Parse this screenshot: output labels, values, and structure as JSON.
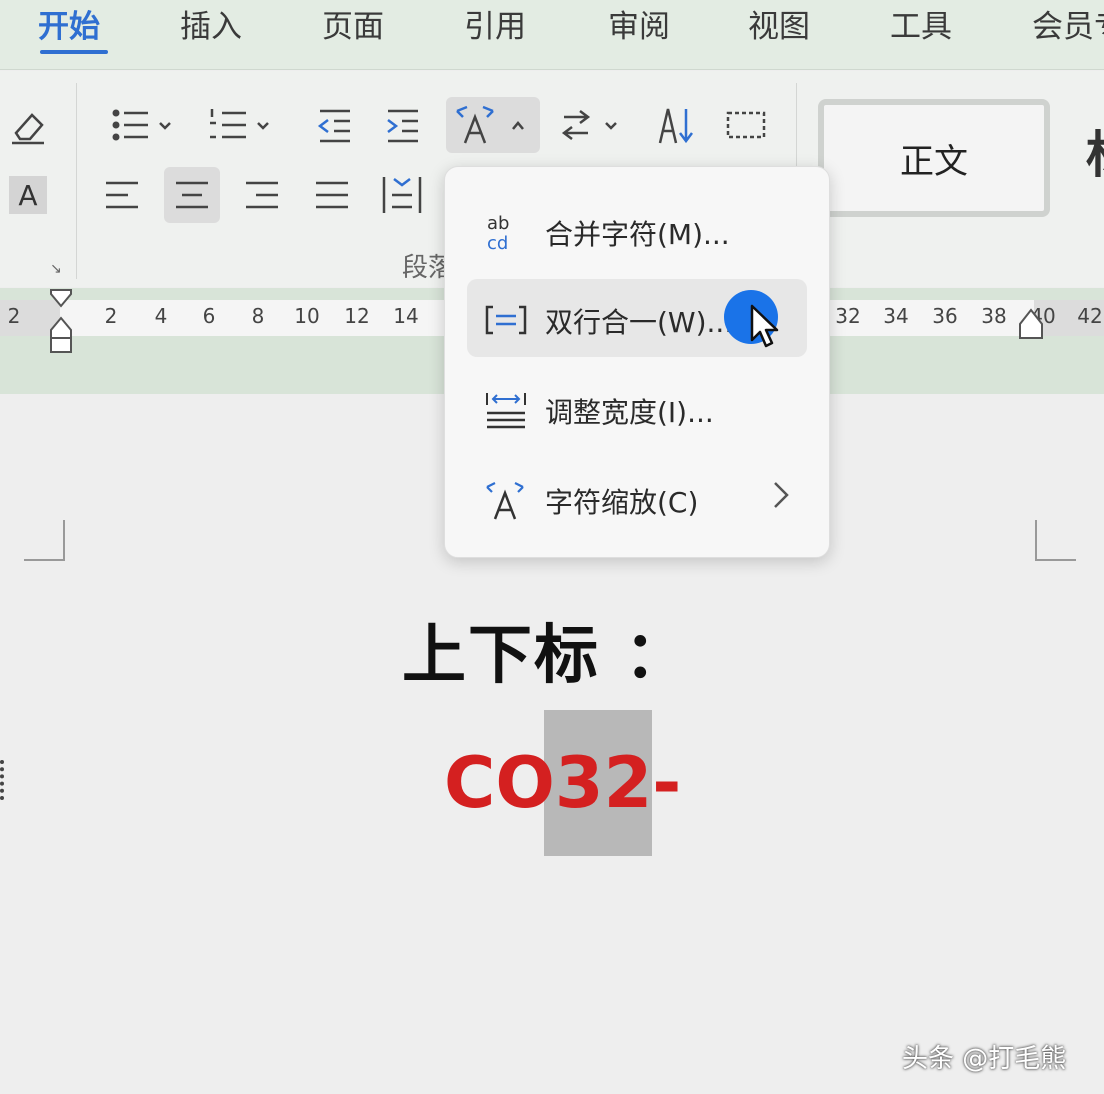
{
  "tabs": [
    {
      "label": "开始",
      "active": true
    },
    {
      "label": "插入",
      "active": false
    },
    {
      "label": "页面",
      "active": false
    },
    {
      "label": "引用",
      "active": false
    },
    {
      "label": "审阅",
      "active": false
    },
    {
      "label": "视图",
      "active": false
    },
    {
      "label": "工具",
      "active": false
    },
    {
      "label": "会员专享",
      "active": false
    }
  ],
  "ribbon": {
    "section_label": "段落",
    "style_gallery": {
      "current": "正文",
      "next_preview": "标"
    },
    "tools_row1": [
      "clear-format-icon",
      "bullet-list-icon",
      "numbered-list-icon",
      "decrease-indent-icon",
      "increase-indent-icon",
      "chinese-layout-icon",
      "text-direction-icon",
      "sort-icon",
      "table-borders-icon"
    ],
    "tools_row2": [
      "font-shading-icon",
      "align-left-icon",
      "align-center-icon",
      "align-right-icon",
      "justify-icon",
      "distributed-icon"
    ],
    "font_shading_letter": "A"
  },
  "ruler": {
    "ticks": [
      "2",
      "2",
      "4",
      "6",
      "8",
      "10",
      "12",
      "14",
      "32",
      "34",
      "36",
      "38",
      "40",
      "42"
    ]
  },
  "dropdown": {
    "items": [
      {
        "label": "合并字符(M)...",
        "icon": "combine-characters-icon",
        "icon_text": "ab cd"
      },
      {
        "label": "双行合一(W)...",
        "icon": "two-lines-in-one-icon",
        "highlighted": true
      },
      {
        "label": "调整宽度(I)...",
        "icon": "adjust-width-icon"
      },
      {
        "label": "字符缩放(C)",
        "icon": "character-scale-icon",
        "has_submenu": true
      }
    ]
  },
  "document": {
    "heading": "上下标 ：",
    "formula": "CO32-"
  },
  "watermark": "头条 @打毛熊",
  "colors": {
    "accent": "#2f6fd1",
    "formula_red": "#d42020",
    "click_dot": "#1a73e8"
  }
}
